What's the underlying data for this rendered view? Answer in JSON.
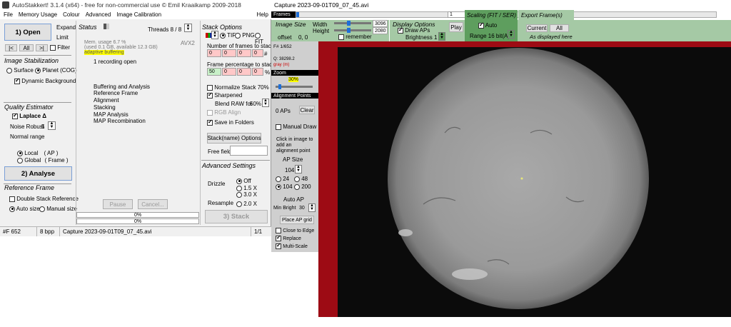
{
  "left_window": {
    "title": "AutoStakkert! 3.1.4 (x64) - free for non-commercial use © Emil Kraaikamp 2009-2018",
    "menu": [
      "File",
      "Memory Usage",
      "Colour",
      "Advanced",
      "Image Calibration"
    ],
    "menu_help": "Help",
    "open_button": "1) Open",
    "expand_label": "Expand",
    "limit_label": "Limit",
    "nav_buttons": [
      "|<",
      "All",
      ">|"
    ],
    "filter_label": "Filter",
    "image_stabilization": {
      "header": "Image Stabilization",
      "surface": "Surface",
      "planet": "Planet (COG)",
      "dynamic_background": "Dynamic Background"
    },
    "quality_estimator": {
      "header": "Quality Estimator",
      "laplace": "Laplace Δ",
      "noise_robust_label": "Noise Robust",
      "noise_robust_value": "5",
      "normal_range": "Normal range",
      "local": "Local",
      "local_suffix": "( AP )",
      "global": "Global",
      "global_suffix": "( Frame )"
    },
    "analyse_button": "2) Analyse",
    "reference_frame": {
      "header": "Reference Frame",
      "double_stack": "Double Stack Reference",
      "auto_size": "Auto size",
      "manual_size": "Manual size"
    },
    "status": {
      "header": "Status",
      "threads": "Threads 8 / 8",
      "mem_line1": "Mem. usage 6.7 %",
      "mem_line2": "(used 0.1 GB, available 12.3 GB)",
      "adaptive": "adaptive buffering",
      "avx": "AVX2",
      "recording": "1 recording open",
      "steps": [
        "Buffering and Analysis",
        "Reference Frame",
        "Alignment",
        "Stacking",
        "MAP Analysis",
        "MAP Recombination"
      ],
      "pause_button": "Pause",
      "cancel_button": "Cancel...",
      "progress1": "0%",
      "progress2": "0%"
    },
    "stack_options": {
      "header": "Stack Options",
      "tif": "TIF",
      "png": "PNG",
      "fit": "FIT",
      "frames_label": "Number of frames to stack:",
      "frames_values": [
        "0",
        "0",
        "0",
        "0"
      ],
      "frames_suffix": "#",
      "percentage_label": "Frame percentage to stack:",
      "percentage_values": [
        "50",
        "0",
        "0",
        "0"
      ],
      "percentage_suffix": "%",
      "normalize": "Normalize Stack 70%",
      "sharpened": "Sharpened",
      "blend_raw": "Blend RAW for",
      "blend_value": "50%",
      "rgb_align": "RGB Align",
      "save_folders": "Save in Folders",
      "stack_name_button": "Stack(name) Options",
      "free_field_label": "Free field",
      "free_field_value": ""
    },
    "advanced_settings": {
      "header": "Advanced Settings",
      "drizzle_label": "Drizzle",
      "drizzle_options": [
        "Off",
        "1.5 X",
        "3.0 X"
      ],
      "resample_label": "Resample",
      "resample_option": "2.0 X"
    },
    "stack_button": "3) Stack",
    "statusbar": {
      "frame": "#F 652",
      "bpp": "8 bpp",
      "file": "Capture 2023-09-01T09_07_45.avi",
      "count": "1/1"
    }
  },
  "right_window": {
    "title": "Capture 2023-09-01T09_07_45.avi",
    "frames_label": "Frames",
    "frame_value": "1",
    "image_size": {
      "header": "Image Size",
      "width_label": "Width",
      "width_value": "3096",
      "height_label": "Height",
      "height_value": "2080",
      "offset_label": "offset",
      "offset_value": "0, 0",
      "remember": "remember"
    },
    "display_options": {
      "header": "Display Options",
      "draw_aps": "Draw APs",
      "brightness": "Brightness 1 x",
      "play_button": "Play"
    },
    "scaling": {
      "header": "Scaling (FIT / SER)",
      "auto": "Auto",
      "range": "Range 16 bit(A)"
    },
    "export": {
      "header": "Export Frame(s)",
      "current_button": "Current",
      "all_button": "All",
      "as_displayed": "As displayed here"
    },
    "side_panel": {
      "frame_num": "F# 1/652",
      "quality": "Q: 38298.2",
      "gray": "gray (m)",
      "zoom_header": "Zoom",
      "zoom_value": "30%",
      "ap_header": "Alignment Points",
      "aps_count": "0 APs",
      "clear_button": "Clear",
      "manual_draw": "Manual Draw",
      "click_help": "Click in image to add an alignment point",
      "ap_size_header": "AP Size",
      "ap_size_value": "104",
      "ap_sizes": [
        "24",
        "48",
        "104",
        "200"
      ],
      "auto_ap": "Auto AP",
      "min_bright_label": "Min Bright",
      "min_bright_value": "30",
      "place_grid_button": "Place AP grid",
      "close_to_edge": "Close to Edge",
      "replace": "Replace",
      "multi_scale": "Multi-Scale"
    }
  },
  "colors": {
    "green_panel": "#a5c9a5",
    "dark_green": "#5e9e5e",
    "red_frame": "#9d0b14",
    "adaptive_highlight": "#ffff00"
  }
}
